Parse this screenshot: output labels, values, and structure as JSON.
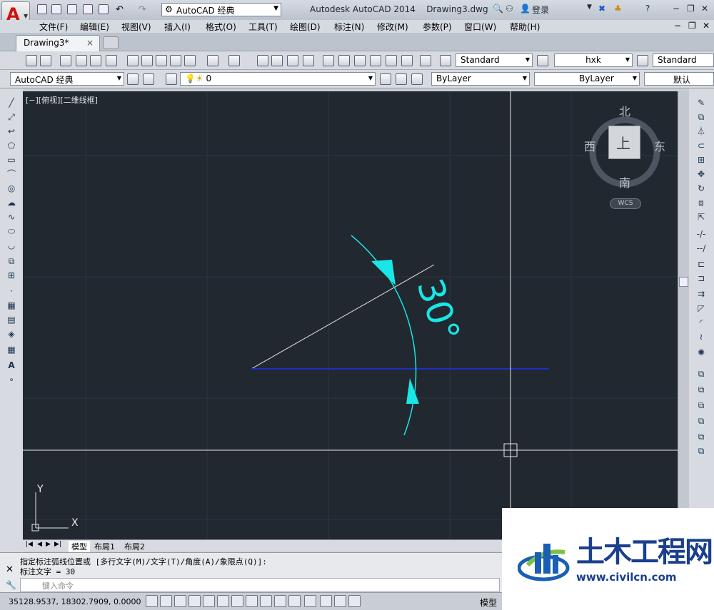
{
  "app": {
    "title": "Autodesk AutoCAD 2014",
    "file": "Drawing3.dwg",
    "workspace": "AutoCAD 经典",
    "login": "登录"
  },
  "menu": [
    "文件(F)",
    "编辑(E)",
    "视图(V)",
    "插入(I)",
    "格式(O)",
    "工具(T)",
    "绘图(D)",
    "标注(N)",
    "修改(M)",
    "参数(P)",
    "窗口(W)",
    "帮助(H)"
  ],
  "document_tab": "Drawing3*",
  "toolbar": {
    "text_style": "Standard",
    "dim_style": "hxk",
    "table_style": "Standard",
    "workspace2": "AutoCAD 经典",
    "layer": "0",
    "color": "ByLayer",
    "linetype": "ByLayer",
    "lineweight": "默认"
  },
  "viewport": {
    "label": "[−][俯视][二维线框]",
    "dimension_text": "30°",
    "viewcube": {
      "top_label": "上",
      "north": "北",
      "south": "南",
      "east": "东",
      "west": "西",
      "wcs": "WCS"
    },
    "ucs": {
      "x": "X",
      "y": "Y"
    }
  },
  "layout_tabs": [
    "模型",
    "布局1",
    "布局2"
  ],
  "command": {
    "line1": "指定标注弧线位置或 [多行文字(M)/文字(T)/角度(A)/象限点(Q)]:",
    "line2": "标注文字 = 30",
    "placeholder": "键入命令"
  },
  "status": {
    "coordinates": "35128.9537, 18302.7909, 0.0000",
    "model": "模型"
  },
  "watermark": {
    "title": "土木工程网",
    "url": "www.civilcn.com"
  },
  "colors": {
    "canvas": "#212830",
    "dimension": "#19e6e6",
    "line_blue": "#1d2fbf",
    "line_white": "#e8e8e8"
  }
}
